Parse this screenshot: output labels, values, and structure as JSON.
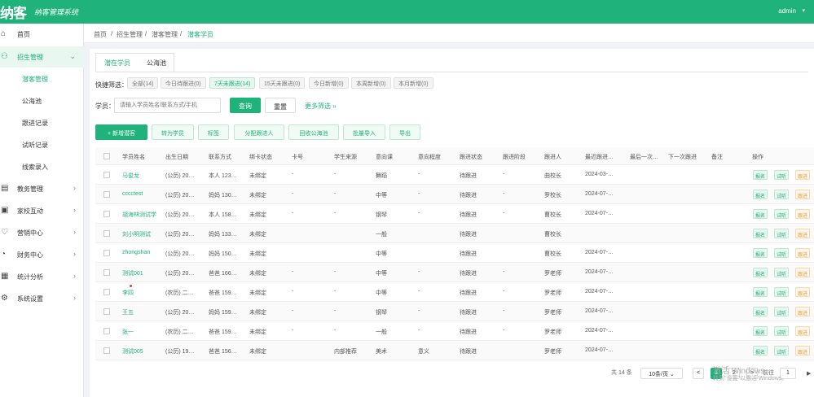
{
  "header": {
    "logo": "纳客",
    "slogan": "纳客管理系统",
    "user": "admin"
  },
  "sidebar": {
    "items": [
      {
        "label": "首页",
        "icon": "home-icon"
      },
      {
        "label": "招生管理",
        "icon": "user-icon"
      },
      {
        "label": "教务管理",
        "icon": "book-icon"
      },
      {
        "label": "家校互动",
        "icon": "chat-icon"
      },
      {
        "label": "营销中心",
        "icon": "gift-icon"
      },
      {
        "label": "财务中心",
        "icon": "money-icon"
      },
      {
        "label": "统计分析",
        "icon": "chart-icon"
      },
      {
        "label": "系统设置",
        "icon": "gear-icon"
      }
    ],
    "sub": [
      {
        "label": "潜客管理"
      },
      {
        "label": "公海池"
      },
      {
        "label": "跟进记录"
      },
      {
        "label": "试听记录"
      },
      {
        "label": "线索录入"
      }
    ]
  },
  "breadcrumb": [
    "首页",
    "招生管理",
    "潜客管理",
    "潜客学员"
  ],
  "tabs": [
    "潜在学员",
    "公海池"
  ],
  "quick_filter": {
    "label": "快捷筛选：",
    "chips": [
      "全部(14)",
      "今日待跟进(0)",
      "7天未跟进(14)",
      "15天未跟进(0)",
      "今日新增(0)",
      "本周新增(0)",
      "本月新增(0)"
    ]
  },
  "search": {
    "label": "学员：",
    "placeholder": "请输入学员姓名/联系方式/手机",
    "query": "查询",
    "reset": "重置",
    "more": "更多筛选 »"
  },
  "actions": [
    "+ 新增潜客",
    "转为学员",
    "标签",
    "分配跟进人",
    "回收公海池",
    "批量导入",
    "导出"
  ],
  "table": {
    "columns": [
      "学员姓名",
      "出生日期",
      "联系方式",
      "绑卡状态",
      "卡号",
      "学生来源",
      "意向课",
      "意向程度",
      "跟进状态",
      "跟进阶段",
      "跟进人",
      "最近跟进…",
      "最后一次…",
      "下一次跟进",
      "备注",
      "操作"
    ],
    "rows": [
      {
        "name": "马俊龙",
        "birth": "(公历) 20…",
        "contact": "本人 123…",
        "card_status": "未绑定",
        "card": "-",
        "source": "-",
        "course": "舞蹈",
        "level": "-",
        "status": "待跟进",
        "stage": "-",
        "owner": "曲校长",
        "last": "2024-03-…"
      },
      {
        "name": "cccctest",
        "birth": "(公历) 20…",
        "contact": "妈妈 130…",
        "card_status": "未绑定",
        "card": "-",
        "source": "-",
        "course": "中等",
        "level": "-",
        "status": "待跟进",
        "stage": "-",
        "owner": "罗校长",
        "last": "2024-07-…"
      },
      {
        "name": "胡海林测试学",
        "birth": "(公历) 20…",
        "contact": "本人 158…",
        "card_status": "未绑定",
        "card": "-",
        "source": "-",
        "course": "钢琴",
        "level": "-",
        "status": "待跟进",
        "stage": "-",
        "owner": "曹校长",
        "last": "2024-07-…"
      },
      {
        "name": "刘小明测试",
        "birth": "(公历) 20…",
        "contact": "妈妈 133…",
        "card_status": "未绑定",
        "card": "",
        "source": "",
        "course": "一般",
        "level": "",
        "status": "待跟进",
        "stage": "",
        "owner": "曹校长",
        "last": ""
      },
      {
        "name": "zhongshan",
        "birth": "(公历) 20…",
        "contact": "妈妈 150…",
        "card_status": "未绑定",
        "card": "",
        "source": "",
        "course": "中等",
        "level": "",
        "status": "待跟进",
        "stage": "",
        "owner": "曹校长",
        "last": "2024-07-…"
      },
      {
        "name": "测试001",
        "birth": "(公历) 20…",
        "contact": "爸爸 166…",
        "card_status": "未绑定",
        "card": "-",
        "source": "-",
        "course": "中等",
        "level": "-",
        "status": "待跟进",
        "stage": "-",
        "owner": "罗老师",
        "last": "2024-07-…"
      },
      {
        "name": "李四",
        "birth": "(农历) 二…",
        "contact": "爸爸 159…",
        "card_status": "未绑定",
        "card": "-",
        "source": "-",
        "course": "中等",
        "level": "-",
        "status": "待跟进",
        "stage": "-",
        "owner": "罗老师",
        "last": "2024-07-…"
      },
      {
        "name": "王五",
        "birth": "(公历) 20…",
        "contact": "妈妈 159…",
        "card_status": "未绑定",
        "card": "-",
        "source": "-",
        "course": "钢琴",
        "level": "-",
        "status": "待跟进",
        "stage": "-",
        "owner": "罗老师",
        "last": "2024-07-…"
      },
      {
        "name": "张一",
        "birth": "(农历) 二…",
        "contact": "爸爸 159…",
        "card_status": "未绑定",
        "card": "-",
        "source": "-",
        "course": "一般",
        "level": "-",
        "status": "待跟进",
        "stage": "-",
        "owner": "罗老师",
        "last": "2024-07-…"
      },
      {
        "name": "测试005",
        "birth": "(公历) 19…",
        "contact": "爸爸 156…",
        "card_status": "未绑定",
        "card": "",
        "source": "内部推荐",
        "course": "美术",
        "level": "意义",
        "status": "待跟进",
        "stage": "",
        "owner": "罗老师",
        "last": "2024-07-…"
      }
    ],
    "ops": [
      "报名",
      "试听",
      "跟进"
    ]
  },
  "pagination": {
    "total": "共 14 条",
    "size": "10条/页",
    "pages": [
      "1",
      "2"
    ],
    "goto_label": "前往",
    "goto_value": "1",
    "prev": "<",
    "next": ">"
  },
  "watermark": {
    "line1": "激活 Windows",
    "line2": "转到\"设置\"以激活 Windows。"
  }
}
